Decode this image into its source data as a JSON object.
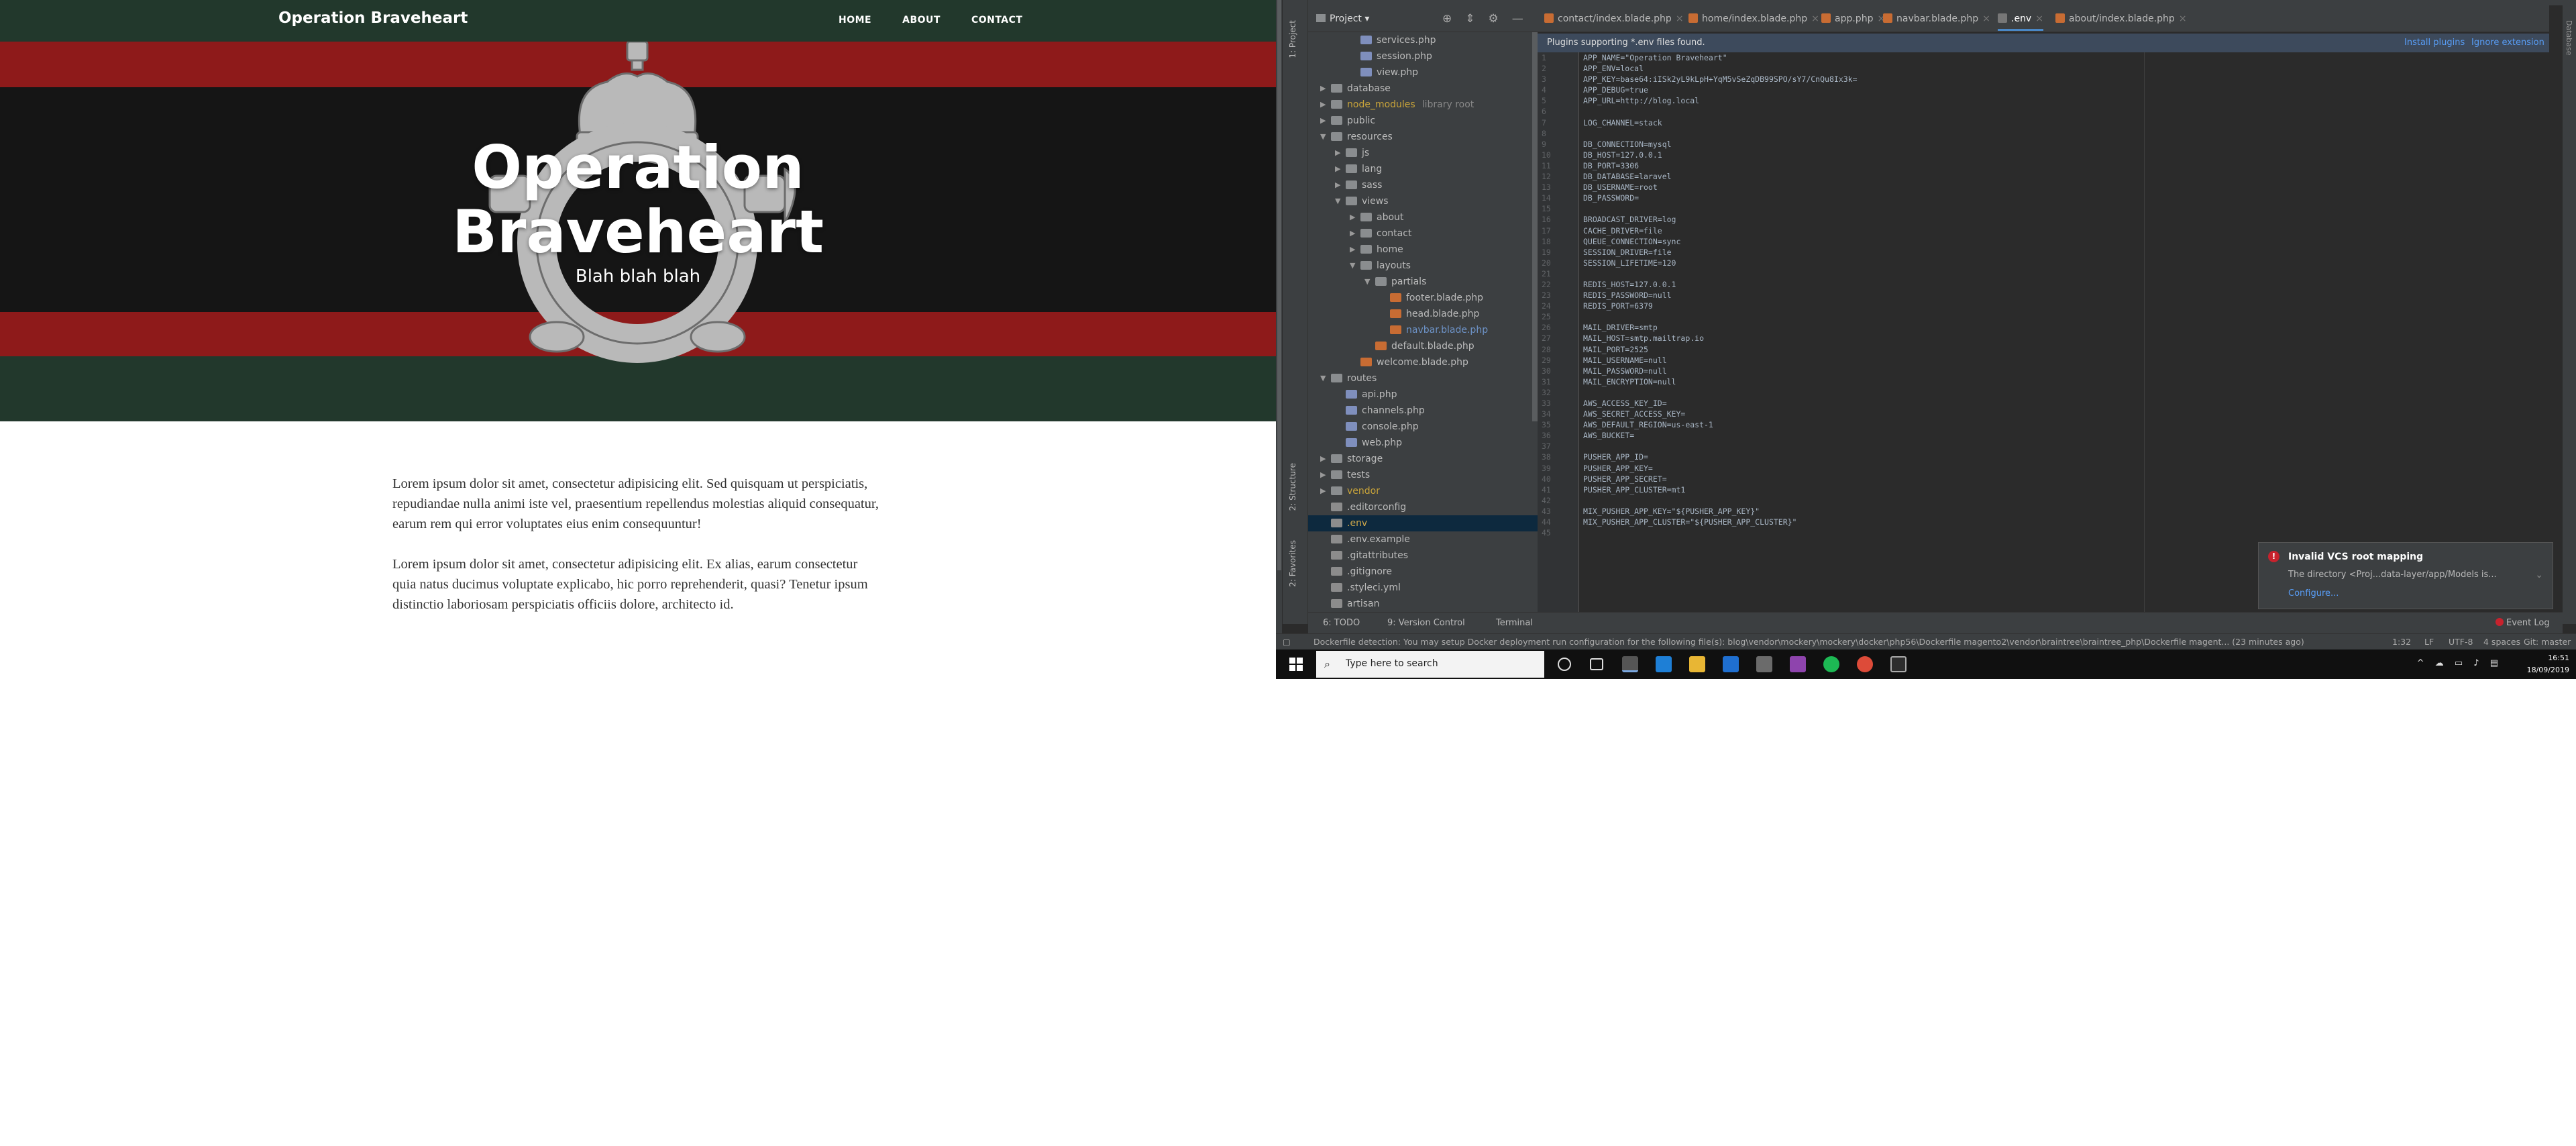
{
  "site": {
    "brand": "Operation Braveheart",
    "nav": [
      "HOME",
      "ABOUT",
      "CONTACT"
    ],
    "hero_title_line1": "Operation",
    "hero_title_line2": "Braveheart",
    "hero_subtitle": "Blah blah blah",
    "paragraphs": [
      "Lorem ipsum dolor sit amet, consectetur adipisicing elit. Sed quisquam ut perspiciatis, repudiandae nulla animi iste vel, praesentium repellendus molestias aliquid consequatur, earum rem qui error voluptates eius enim consequuntur!",
      "Lorem ipsum dolor sit amet, consectetur adipisicing elit. Ex alias, earum consectetur quia natus ducimus voluptate explicabo, hic porro reprehenderit, quasi? Tenetur ipsum distinctio laboriosam perspiciatis officiis dolore, architecto id."
    ],
    "colors": {
      "green": "#22382c",
      "red": "#8e1a1a",
      "black": "#151515"
    }
  },
  "ide": {
    "left_strip": [
      "1: Project",
      "2: Structure",
      "2: Favorites"
    ],
    "right_strip": "Database",
    "project_label": "Project",
    "tree": [
      {
        "name": "services.php",
        "type": "php"
      },
      {
        "name": "session.php",
        "type": "php"
      },
      {
        "name": "view.php",
        "type": "php"
      },
      {
        "name": "database",
        "type": "folder"
      },
      {
        "name": "node_modules",
        "type": "folder",
        "extra": "library root"
      },
      {
        "name": "public",
        "type": "folder"
      },
      {
        "name": "resources",
        "type": "folder"
      },
      {
        "name": "js",
        "type": "folder"
      },
      {
        "name": "lang",
        "type": "folder"
      },
      {
        "name": "sass",
        "type": "folder"
      },
      {
        "name": "views",
        "type": "folder"
      },
      {
        "name": "about",
        "type": "folder"
      },
      {
        "name": "contact",
        "type": "folder"
      },
      {
        "name": "home",
        "type": "folder"
      },
      {
        "name": "layouts",
        "type": "folder"
      },
      {
        "name": "partials",
        "type": "folder"
      },
      {
        "name": "footer.blade.php",
        "type": "blade"
      },
      {
        "name": "head.blade.php",
        "type": "blade"
      },
      {
        "name": "navbar.blade.php",
        "type": "blade"
      },
      {
        "name": "default.blade.php",
        "type": "blade"
      },
      {
        "name": "welcome.blade.php",
        "type": "blade"
      },
      {
        "name": "routes",
        "type": "folder"
      },
      {
        "name": "api.php",
        "type": "php"
      },
      {
        "name": "channels.php",
        "type": "php"
      },
      {
        "name": "console.php",
        "type": "php"
      },
      {
        "name": "web.php",
        "type": "php"
      },
      {
        "name": "storage",
        "type": "folder"
      },
      {
        "name": "tests",
        "type": "folder"
      },
      {
        "name": "vendor",
        "type": "folder"
      },
      {
        "name": ".editorconfig",
        "type": "cfg"
      },
      {
        "name": ".env",
        "type": "cfg",
        "selected": true
      },
      {
        "name": ".env.example",
        "type": "cfg"
      },
      {
        "name": ".gitattributes",
        "type": "cfg"
      },
      {
        "name": ".gitignore",
        "type": "cfg"
      },
      {
        "name": ".styleci.yml",
        "type": "cfg"
      },
      {
        "name": "artisan",
        "type": "cfg"
      }
    ],
    "tabs": [
      {
        "label": "contact/index.blade.php"
      },
      {
        "label": "home/index.blade.php"
      },
      {
        "label": "app.php"
      },
      {
        "label": "navbar.blade.php"
      },
      {
        "label": ".env",
        "active": true
      },
      {
        "label": "about/index.blade.php"
      }
    ],
    "banner": {
      "message": "Plugins supporting *.env files found.",
      "action1": "Install plugins",
      "action2": "Ignore extension"
    },
    "code_lines": [
      "APP_NAME=\"Operation Braveheart\"",
      "APP_ENV=local",
      "APP_KEY=base64:iISk2yL9kLpH+YqM5vSeZqDB99SPO/sY7/CnQu8Ix3k=",
      "APP_DEBUG=true",
      "APP_URL=http://blog.local",
      "",
      "LOG_CHANNEL=stack",
      "",
      "DB_CONNECTION=mysql",
      "DB_HOST=127.0.0.1",
      "DB_PORT=3306",
      "DB_DATABASE=laravel",
      "DB_USERNAME=root",
      "DB_PASSWORD=",
      "",
      "BROADCAST_DRIVER=log",
      "CACHE_DRIVER=file",
      "QUEUE_CONNECTION=sync",
      "SESSION_DRIVER=file",
      "SESSION_LIFETIME=120",
      "",
      "REDIS_HOST=127.0.0.1",
      "REDIS_PASSWORD=null",
      "REDIS_PORT=6379",
      "",
      "MAIL_DRIVER=smtp",
      "MAIL_HOST=smtp.mailtrap.io",
      "MAIL_PORT=2525",
      "MAIL_USERNAME=null",
      "MAIL_PASSWORD=null",
      "MAIL_ENCRYPTION=null",
      "",
      "AWS_ACCESS_KEY_ID=",
      "AWS_SECRET_ACCESS_KEY=",
      "AWS_DEFAULT_REGION=us-east-1",
      "AWS_BUCKET=",
      "",
      "PUSHER_APP_ID=",
      "PUSHER_APP_KEY=",
      "PUSHER_APP_SECRET=",
      "PUSHER_APP_CLUSTER=mt1",
      "",
      "MIX_PUSHER_APP_KEY=\"${PUSHER_APP_KEY}\"",
      "MIX_PUSHER_APP_CLUSTER=\"${PUSHER_APP_CLUSTER}\"",
      ""
    ],
    "notification": {
      "title": "Invalid VCS root mapping",
      "body": "The directory <Proj...data-layer/app/Models is...",
      "link": "Configure..."
    },
    "toolbar": {
      "todo": "6: TODO",
      "vcs": "9: Version Control",
      "terminal": "Terminal",
      "event_log": "Event Log"
    },
    "status": {
      "message": "Dockerfile detection: You may setup Docker deployment run configuration for the following file(s): blog\\vendor\\mockery\\mockery\\docker\\php56\\Dockerfile magento2\\vendor\\braintree\\braintree_php\\Dockerfile magent... (23 minutes ago)",
      "position": "1:32",
      "line_sep": "LF",
      "encoding": "UTF-8",
      "indent": "4 spaces",
      "git": "Git: master"
    }
  },
  "taskbar": {
    "search_placeholder": "Type here to search",
    "time": "16:51",
    "date": "18/09/2019"
  }
}
